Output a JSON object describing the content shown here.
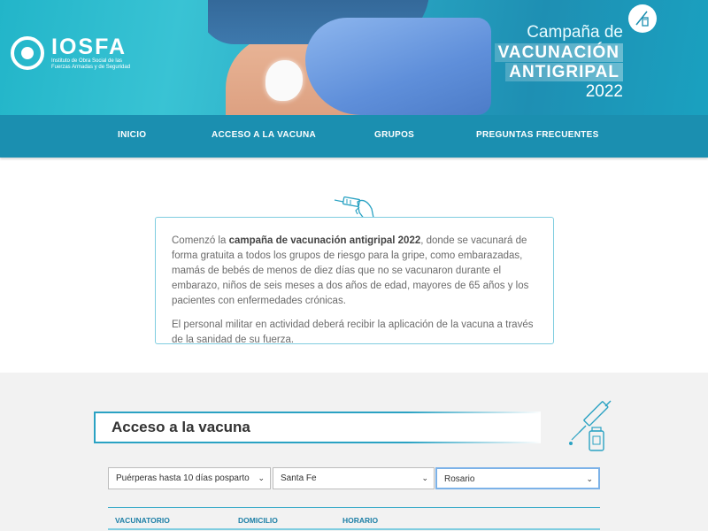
{
  "header": {
    "logo_name": "IOSFA",
    "logo_sub": "Instituto de Obra Social de las Fuerzas Armadas y de Seguridad",
    "campaign_line1": "Campaña de",
    "campaign_line2": "VACUNACIÓN",
    "campaign_line3": "ANTIGRIPAL",
    "campaign_year": "2022",
    "icons": [
      "iosfa-logo-icon",
      "vaccine-icon"
    ]
  },
  "nav": {
    "items": [
      "INICIO",
      "ACCESO A LA VACUNA",
      "GRUPOS",
      "PREGUNTAS FRECUENTES"
    ]
  },
  "intro": {
    "p1_before": "Comenzó la ",
    "p1_bold": "campaña de vacunación antigripal 2022",
    "p1_after": ", donde se vacunará de forma gratuita a todos los grupos de riesgo para la gripe, como embarazadas, mamás de bebés de menos de diez días que no se vacunaron durante el embarazo, niños de seis meses a dos años de edad, mayores de 65 años y los pacientes con enfermedades crónicas.",
    "p2": "El personal militar en actividad deberá recibir la aplicación de la vacuna a través de la sanidad de su fuerza.",
    "icon": "syringe-hand-icon"
  },
  "access": {
    "title": "Acceso a la vacuna",
    "icon": "syringe-vial-icon",
    "filters": {
      "group": "Puérperas hasta 10 días posparto",
      "province": "Santa Fe",
      "city": "Rosario"
    },
    "table_headers": [
      "VACUNATORIO",
      "DOMICILIO",
      "HORARIO"
    ]
  },
  "colors": {
    "accent": "#1b8fb0",
    "border": "#7fcde0",
    "header_link": "#1d7fa6"
  }
}
